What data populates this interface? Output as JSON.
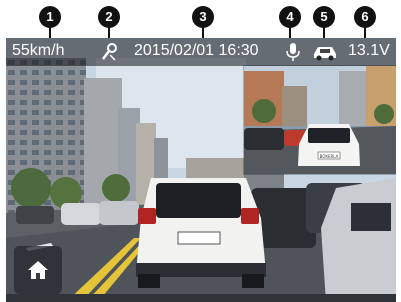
{
  "markers": [
    "1",
    "2",
    "3",
    "4",
    "5",
    "6"
  ],
  "status_bar": {
    "speed": "55km/h",
    "datetime": "2015/02/01 16:30",
    "voltage": "13.1V",
    "icons": [
      "gps-icon",
      "microphone-icon",
      "car-icon"
    ]
  },
  "views": {
    "front_camera": "front-camera-view",
    "rear_camera": "rear-camera-pip",
    "rear_plate": "BOXERLA"
  },
  "controls": {
    "home_icon": "home-icon"
  },
  "colors": {
    "marker_bg": "#111111",
    "status_text": "#ffffff",
    "status_bar_bg": "#14161a"
  }
}
